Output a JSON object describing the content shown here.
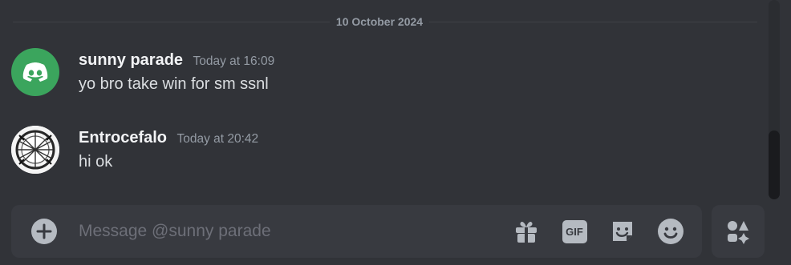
{
  "date_divider": "10 October 2024",
  "messages": [
    {
      "username": "sunny parade",
      "timestamp": "Today at 16:09",
      "text": "yo bro take win for sm ssnl",
      "avatar_icon": "discord-logo-icon",
      "avatar_color": "#3ba55d"
    },
    {
      "username": "Entrocefalo",
      "timestamp": "Today at 20:42",
      "text": "hi ok",
      "avatar_icon": "user-avatar-image",
      "avatar_color": "#ffffff"
    }
  ],
  "composer": {
    "placeholder": "Message @sunny parade",
    "value": "",
    "add_icon": "plus-circle-icon",
    "gift_icon": "gift-icon",
    "gif_label": "GIF",
    "sticker_icon": "sticker-icon",
    "emoji_icon": "smile-icon"
  },
  "apps": {
    "icon": "apps-icon"
  },
  "colors": {
    "background": "#313338",
    "composer": "#383a40",
    "text": "#dbdee1",
    "muted": "#949ba4",
    "icon": "#b5bac1"
  }
}
